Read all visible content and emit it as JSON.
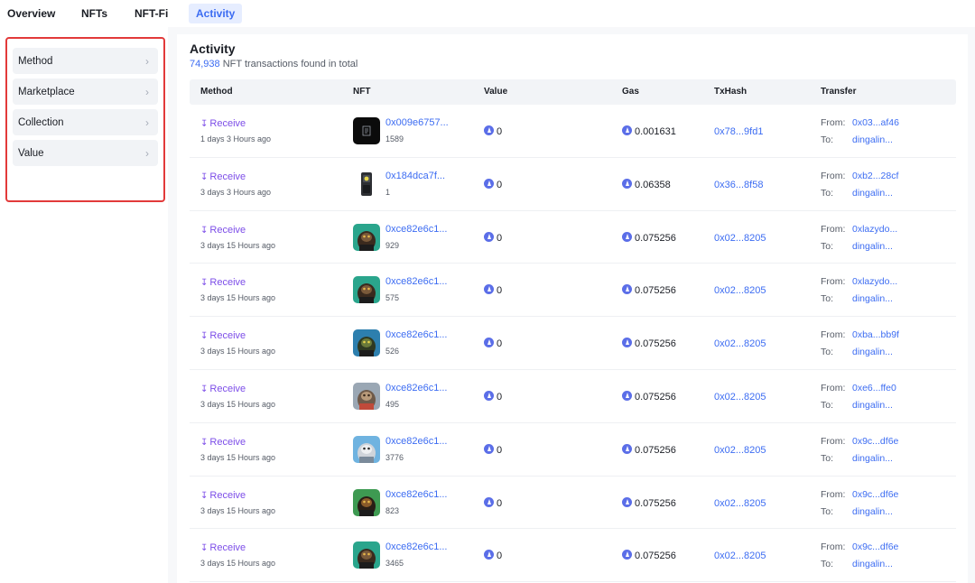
{
  "tabs": [
    {
      "label": "Overview",
      "active": false
    },
    {
      "label": "NFTs",
      "active": false
    },
    {
      "label": "NFT-Fi",
      "active": false
    },
    {
      "label": "Activity",
      "active": true
    }
  ],
  "filters": [
    {
      "label": "Method"
    },
    {
      "label": "Marketplace"
    },
    {
      "label": "Collection"
    },
    {
      "label": "Value"
    }
  ],
  "activity": {
    "title": "Activity",
    "count": "74,938",
    "count_suffix": " NFT transactions found in total",
    "columns": [
      "Method",
      "NFT",
      "Value",
      "Gas",
      "TxHash",
      "Transfer"
    ],
    "from_label": "From:",
    "to_label": "To:",
    "rows": [
      {
        "method": "Receive",
        "time": "1 days 3 Hours ago",
        "nft_addr": "0x009e6757...",
        "nft_id": "1589",
        "thumb": "black",
        "value": "0",
        "gas": "0.001631",
        "tx": "0x78...9fd1",
        "from": "0x03...af46",
        "to": "dingalin..."
      },
      {
        "method": "Receive",
        "time": "3 days 3 Hours ago",
        "nft_addr": "0x184dca7f...",
        "nft_id": "1",
        "thumb": "device",
        "value": "0",
        "gas": "0.06358",
        "tx": "0x36...8f58",
        "from": "0xb2...28cf",
        "to": "dingalin..."
      },
      {
        "method": "Receive",
        "time": "3 days 15 Hours ago",
        "nft_addr": "0xce82e6c1...",
        "nft_id": "929",
        "thumb": "teal",
        "value": "0",
        "gas": "0.075256",
        "tx": "0x02...8205",
        "from": "0xlazydo...",
        "to": "dingalin..."
      },
      {
        "method": "Receive",
        "time": "3 days 15 Hours ago",
        "nft_addr": "0xce82e6c1...",
        "nft_id": "575",
        "thumb": "teal",
        "value": "0",
        "gas": "0.075256",
        "tx": "0x02...8205",
        "from": "0xlazydo...",
        "to": "dingalin..."
      },
      {
        "method": "Receive",
        "time": "3 days 15 Hours ago",
        "nft_addr": "0xce82e6c1...",
        "nft_id": "526",
        "thumb": "blue",
        "value": "0",
        "gas": "0.075256",
        "tx": "0x02...8205",
        "from": "0xba...bb9f",
        "to": "dingalin..."
      },
      {
        "method": "Receive",
        "time": "3 days 15 Hours ago",
        "nft_addr": "0xce82e6c1...",
        "nft_id": "495",
        "thumb": "grey",
        "value": "0",
        "gas": "0.075256",
        "tx": "0x02...8205",
        "from": "0xe6...ffe0",
        "to": "dingalin..."
      },
      {
        "method": "Receive",
        "time": "3 days 15 Hours ago",
        "nft_addr": "0xce82e6c1...",
        "nft_id": "3776",
        "thumb": "sky",
        "value": "0",
        "gas": "0.075256",
        "tx": "0x02...8205",
        "from": "0x9c...df6e",
        "to": "dingalin..."
      },
      {
        "method": "Receive",
        "time": "3 days 15 Hours ago",
        "nft_addr": "0xce82e6c1...",
        "nft_id": "823",
        "thumb": "green",
        "value": "0",
        "gas": "0.075256",
        "tx": "0x02...8205",
        "from": "0x9c...df6e",
        "to": "dingalin..."
      },
      {
        "method": "Receive",
        "time": "3 days 15 Hours ago",
        "nft_addr": "0xce82e6c1...",
        "nft_id": "3465",
        "thumb": "teal",
        "value": "0",
        "gas": "0.075256",
        "tx": "0x02...8205",
        "from": "0x9c...df6e",
        "to": "dingalin..."
      }
    ]
  },
  "colors": {
    "accent": "#3c6cf2",
    "method": "#7c4de8",
    "highlight_border": "#e23a3a",
    "active_tab_bg": "#e6edff"
  },
  "icons": {
    "method": "receive-arrow-icon",
    "value": "eth-icon",
    "filter": "chevron-right-icon"
  }
}
